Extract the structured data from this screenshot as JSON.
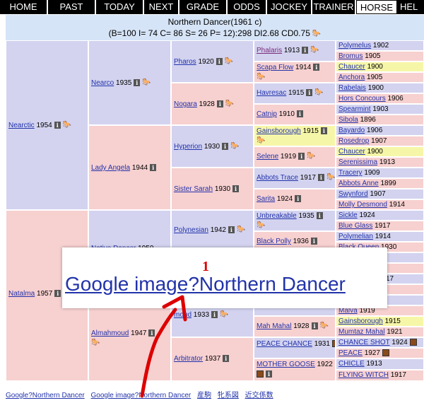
{
  "tabs": [
    "HOME",
    "PAST",
    "TODAY",
    "NEXT",
    "GRADE",
    "ODDS",
    "JOCKEY",
    "TRAINER",
    "HORSE",
    "HEL"
  ],
  "active_tab": "HORSE",
  "header": {
    "title": "Northern Dancer(1961 c)",
    "stats": "(B=100 I= 74 C= 86 S= 26 P= 12):298 DI2.68 CD0.75"
  },
  "icons": {
    "info": "i",
    "horse": "horse-icon",
    "box": "brown-box"
  },
  "colors": {
    "blue": "#d3d3f0",
    "pink": "#f7d0d0",
    "yellow": "#f6f6a8",
    "link": "#2233aa",
    "arrow": "#dd0000"
  },
  "sires": [
    "Nearctic",
    "1954",
    "Natalma",
    "1957"
  ],
  "gen1": {
    "nearctic": {
      "name": "Nearctic",
      "year": "1954"
    },
    "natalma": {
      "name": "Natalma",
      "year": "1957"
    }
  },
  "gen2": {
    "nearco": {
      "name": "Nearco",
      "year": "1935"
    },
    "lady_angela": {
      "name": "Lady Angela",
      "year": "1944"
    },
    "native_dancer": {
      "name": "Native Dancer",
      "year": "1950"
    },
    "almahmoud": {
      "name": "Almahmoud",
      "year": "1947"
    }
  },
  "gen3": {
    "pharos": {
      "name": "Pharos",
      "year": "1920"
    },
    "nogara": {
      "name": "Nogara",
      "year": "1928"
    },
    "hyperion": {
      "name": "Hyperion",
      "year": "1930"
    },
    "sister_sarah": {
      "name": "Sister Sarah",
      "year": "1930"
    },
    "polynesian": {
      "name": "Polynesian",
      "year": "1942"
    },
    "mahmoud": {
      "name": "moud",
      "year": "1933"
    },
    "arbitrator": {
      "name": "Arbitrator",
      "year": "1937"
    }
  },
  "gen4": {
    "phalaris": {
      "name": "Phalaris",
      "year": "1913"
    },
    "scapa_flow": {
      "name": "Scapa Flow",
      "year": "1914"
    },
    "havresac": {
      "name": "Havresac",
      "year": "1915"
    },
    "catnip": {
      "name": "Catnip",
      "year": "1910"
    },
    "gainsborough": {
      "name": "Gainsborough",
      "year": "1915"
    },
    "selene": {
      "name": "Selene",
      "year": "1919"
    },
    "abbots_trace": {
      "name": "Abbots Trace",
      "year": "1917"
    },
    "sarita": {
      "name": "Sarita",
      "year": "1924"
    },
    "unbreakable": {
      "name": "Unbreakable",
      "year": "1935"
    },
    "black_polly": {
      "name": "Black Polly",
      "year": "1936"
    },
    "mah_mahal": {
      "name": "Mah Mahal",
      "year": "1928"
    },
    "peace_chance": {
      "name": "PEACE CHANCE",
      "year": "1931"
    },
    "mother_goose": {
      "name": "MOTHER GOOSE",
      "year": "1922"
    }
  },
  "gen5": {
    "polymelus": {
      "name": "Polymelus",
      "year": "1902"
    },
    "bromus": {
      "name": "Bromus",
      "year": "1905"
    },
    "chaucer1": {
      "name": "Chaucer",
      "year": "1900"
    },
    "anchora": {
      "name": "Anchora",
      "year": "1905"
    },
    "rabelais": {
      "name": "Rabelais",
      "year": "1900"
    },
    "hors_concours": {
      "name": "Hors Concours",
      "year": "1906"
    },
    "spearmint": {
      "name": "Spearmint",
      "year": "1903"
    },
    "sibola": {
      "name": "Sibola",
      "year": "1896"
    },
    "bayardo": {
      "name": "Bayardo",
      "year": "1906"
    },
    "rosedrop": {
      "name": "Rosedrop",
      "year": "1907"
    },
    "chaucer2": {
      "name": "Chaucer",
      "year": "1900"
    },
    "serenissima": {
      "name": "Serenissima",
      "year": "1913"
    },
    "tracery": {
      "name": "Tracery",
      "year": "1909"
    },
    "abbots_anne": {
      "name": "Abbots Anne",
      "year": "1899"
    },
    "swynford": {
      "name": "Swynford",
      "year": "1907"
    },
    "molly_desmond": {
      "name": "Molly Desmond",
      "year": "1914"
    },
    "sickle": {
      "name": "Sickle",
      "year": "1924"
    },
    "blue_glass": {
      "name": "Blue Glass",
      "year": "1917"
    },
    "polymelian": {
      "name": "Polymelian",
      "year": "1914"
    },
    "black_queen": {
      "name": "Black Queen",
      "year": "1930"
    },
    "malva": {
      "name": "Malva",
      "year": "1919"
    },
    "gainsborough2": {
      "name": "Gainsborough",
      "year": "1915"
    },
    "mumtaz_mahal": {
      "name": "Mumtaz Mahal",
      "year": "1921"
    },
    "chance_shot": {
      "name": "CHANCE SHOT",
      "year": "1924"
    },
    "peace": {
      "name": "PEACE",
      "year": "1927"
    },
    "chicle": {
      "name": "CHICLE",
      "year": "1913"
    },
    "flying_witch": {
      "name": "FLYING WITCH",
      "year": "1917"
    },
    "partial_1917": {
      "year": "17"
    }
  },
  "footer": {
    "link1": "Google?Northern Dancer",
    "link2": "Google image?Northern Dancer",
    "link3": "産駒",
    "link4": "牝系図",
    "link5": "近交係数"
  },
  "zoom": {
    "text": "Google image?Northern Dancer",
    "callout_number": "1"
  }
}
